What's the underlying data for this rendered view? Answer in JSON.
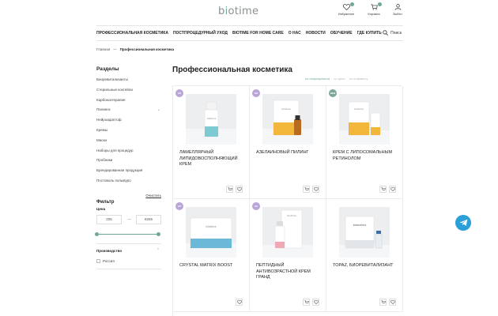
{
  "header": {
    "logo_pre": "b",
    "logo_i": "i",
    "logo_post": "otime",
    "favorites_label": "Избранное",
    "cart_label": "Корзина",
    "login_label": "Войти"
  },
  "nav": {
    "items": [
      "ПРОФЕССИОНАЛЬНАЯ КОСМЕТИКА",
      "ПОСТПРОЦЕДУРНЫЙ УХОД",
      "BIOTIME FOR HOME CARE",
      "О НАС",
      "НОВОСТИ",
      "ОБУЧЕНИЕ",
      "ГДЕ КУПИТЬ"
    ],
    "search_label": "Поиск"
  },
  "breadcrumb": {
    "home": "Главная",
    "separator": "—",
    "current": "Профессиональная косметика"
  },
  "sidebar": {
    "title": "Разделы",
    "items": [
      "Биоревитализанты",
      "Стерильные коктейли",
      "Карбокситерапия",
      "Пилинги",
      "Нейроадаптоф",
      "Кремы",
      "Маски",
      "Наборы для процедур",
      "Пробники",
      "Брендированная продукция",
      "Постоволь полывуро"
    ]
  },
  "filter": {
    "title": "Фильтр",
    "clear_label": "Очистить",
    "price_label": "Цена",
    "price_min": "205",
    "price_dash": "—",
    "price_max": "8265",
    "price_low_fraction": 0.0,
    "price_high_fraction": 1.0,
    "manufacturer_label": "Производство",
    "country": "Россия"
  },
  "main": {
    "title": "Профессиональная косметика",
    "sorts": [
      "по популярности",
      "по цене",
      "по алфавиту"
    ]
  },
  "products": [
    {
      "name": "ЛАМЕЛЛЯРНЫЙ ЛИПИДОВОСПОЛНЯЮЩИЙ КРЕМ",
      "badge": "HIT",
      "badge_color": "#b9a5d8"
    },
    {
      "name": "АЗЕЛАИНОВЫЙ ПИЛИНГ",
      "badge": "HIT",
      "badge_color": "#b9a5d8"
    },
    {
      "name": "КРЕМ С ЛИПОСОМАЛЬНЫМ РЕТИНОЛОМ",
      "badge": "NEW",
      "badge_color": "#7fa69a"
    },
    {
      "name": "CRYSTAL MATRIX BOOST",
      "badge": "HIT",
      "badge_color": "#b9a5d8"
    },
    {
      "name": "ПЕПТИДНЫЙ АНТИВОЗРАСТНОЙ КРЕМ ГРАНД",
      "badge": "HIT",
      "badge_color": "#b9a5d8"
    },
    {
      "name": "TOPAZ, БИОРЕВИТАЛИЗАНТ",
      "badge": "",
      "badge_color": ""
    }
  ],
  "colors": {
    "accent": "#6fa89a",
    "telegram": "#2a9fd8"
  }
}
